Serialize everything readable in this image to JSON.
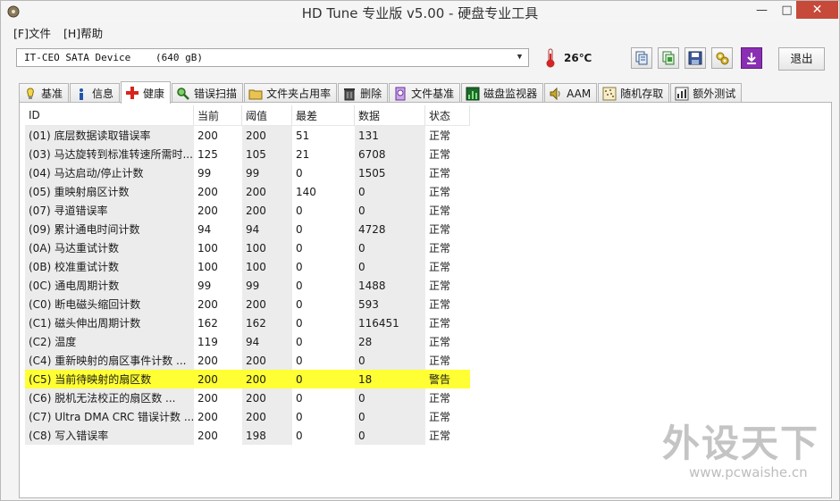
{
  "window": {
    "title": "HD Tune 专业版 v5.00 - 硬盘专业工具",
    "minimize": "—",
    "maximize": "□",
    "close": "✕"
  },
  "menu": {
    "file": "[F]文件",
    "help": "[H]帮助"
  },
  "toolbar": {
    "drive_name": "IT-CEO  SATA  Device",
    "drive_capacity": "(640 gB)",
    "temperature": "26℃",
    "exit_label": "退出",
    "icons": [
      "copy-info-icon",
      "copy-screen-icon",
      "save-icon",
      "options-icon",
      "download-icon"
    ]
  },
  "tabs": [
    {
      "label": "基准",
      "icon": "benchmark-icon"
    },
    {
      "label": "信息",
      "icon": "info-icon"
    },
    {
      "label": "健康",
      "icon": "health-icon"
    },
    {
      "label": "错误扫描",
      "icon": "error-scan-icon"
    },
    {
      "label": "文件夹占用率",
      "icon": "folder-usage-icon"
    },
    {
      "label": "删除",
      "icon": "erase-icon"
    },
    {
      "label": "文件基准",
      "icon": "file-benchmark-icon"
    },
    {
      "label": "磁盘监视器",
      "icon": "disk-monitor-icon"
    },
    {
      "label": "AAM",
      "icon": "speaker-icon"
    },
    {
      "label": "随机存取",
      "icon": "random-access-icon"
    },
    {
      "label": "额外测试",
      "icon": "extra-tests-icon"
    }
  ],
  "active_tab": "健康",
  "health_table": {
    "columns": [
      "ID",
      "当前",
      "阈值",
      "最差",
      "数据",
      "状态"
    ],
    "rows": [
      [
        "(01) 底层数据读取错误率",
        "200",
        "200",
        "51",
        "131",
        "正常"
      ],
      [
        "(03) 马达旋转到标准转速所需时...",
        "125",
        "105",
        "21",
        "6708",
        "正常"
      ],
      [
        "(04) 马达启动/停止计数",
        "99",
        "99",
        "0",
        "1505",
        "正常"
      ],
      [
        "(05) 重映射扇区计数",
        "200",
        "200",
        "140",
        "0",
        "正常"
      ],
      [
        "(07) 寻道错误率",
        "200",
        "200",
        "0",
        "0",
        "正常"
      ],
      [
        "(09) 累计通电时间计数",
        "94",
        "94",
        "0",
        "4728",
        "正常"
      ],
      [
        "(0A) 马达重试计数",
        "100",
        "100",
        "0",
        "0",
        "正常"
      ],
      [
        "(0B) 校准重试计数",
        "100",
        "100",
        "0",
        "0",
        "正常"
      ],
      [
        "(0C) 通电周期计数",
        "99",
        "99",
        "0",
        "1488",
        "正常"
      ],
      [
        "(C0) 断电磁头缩回计数",
        "200",
        "200",
        "0",
        "593",
        "正常"
      ],
      [
        "(C1) 磁头伸出周期计数",
        "162",
        "162",
        "0",
        "116451",
        "正常"
      ],
      [
        "(C2) 温度",
        "119",
        "94",
        "0",
        "28",
        "正常"
      ],
      [
        "(C4) 重新映射的扇区事件计数  ...",
        "200",
        "200",
        "0",
        "0",
        "正常"
      ],
      [
        "(C5) 当前待映射的扇区数",
        "200",
        "200",
        "0",
        "18",
        "警告"
      ],
      [
        "(C6) 脱机无法校正的扇区数  ...",
        "200",
        "200",
        "0",
        "0",
        "正常"
      ],
      [
        "(C7) Ultra DMA CRC 错误计数  ...",
        "200",
        "200",
        "0",
        "0",
        "正常"
      ],
      [
        "(C8) 写入错误率",
        "200",
        "198",
        "0",
        "0",
        "正常"
      ]
    ],
    "warning_row_color": "#ffff33"
  },
  "watermark": {
    "brand": "外设天下",
    "url": "www.pcwaishe.cn"
  }
}
